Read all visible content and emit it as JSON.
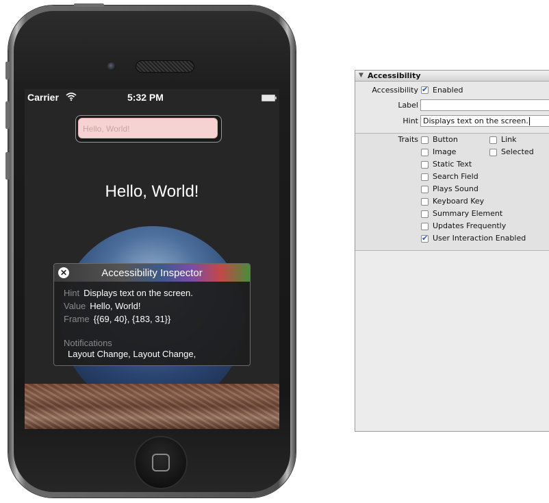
{
  "device": {
    "status_bar": {
      "carrier": "Carrier",
      "time": "5:32 PM"
    },
    "text_field": {
      "placeholder": "Hello, World!"
    },
    "label_text": "Hello, World!",
    "inspector": {
      "title": "Accessibility Inspector",
      "hint_key": "Hint",
      "hint_value": "Displays text on the screen.",
      "value_key": "Value",
      "value_value": "Hello, World!",
      "frame_key": "Frame",
      "frame_value": "{{69, 40}, {183, 31}}",
      "notifications_key": "Notifications",
      "notifications_value": "Layout Change, Layout Change,"
    }
  },
  "panel": {
    "title": "Accessibility",
    "accessibility_label": "Accessibility",
    "enabled_label": "Enabled",
    "enabled_checked": true,
    "label_label": "Label",
    "label_value": "",
    "hint_label": "Hint",
    "hint_value": "Displays text on the screen.",
    "traits_label": "Traits",
    "traits": [
      {
        "label": "Button",
        "checked": false
      },
      {
        "label": "Link",
        "checked": false
      },
      {
        "label": "Image",
        "checked": false
      },
      {
        "label": "Selected",
        "checked": false
      },
      {
        "label": "Static Text",
        "checked": false
      },
      {
        "label": "Search Field",
        "checked": false
      },
      {
        "label": "Plays Sound",
        "checked": false
      },
      {
        "label": "Keyboard Key",
        "checked": false
      },
      {
        "label": "Summary Element",
        "checked": false
      },
      {
        "label": "Updates Frequently",
        "checked": false
      },
      {
        "label": "User Interaction Enabled",
        "checked": true
      }
    ]
  }
}
